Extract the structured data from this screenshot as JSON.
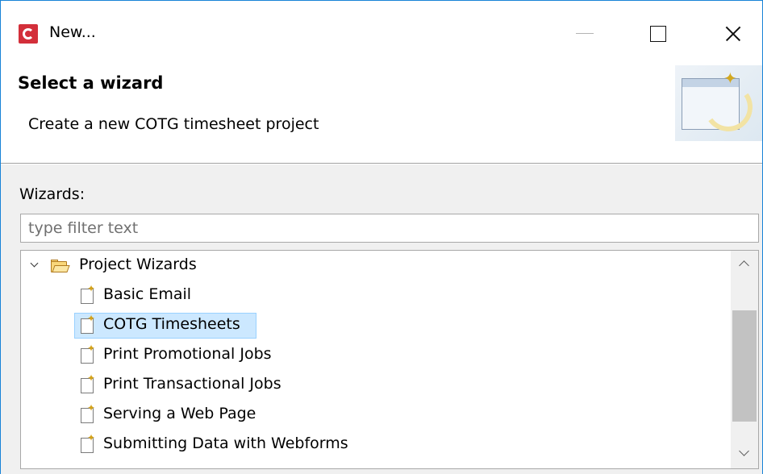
{
  "window": {
    "title": "New...",
    "app_icon": "c-logo-icon",
    "controls": {
      "minimize": "minimize-icon",
      "maximize": "maximize-icon",
      "close": "close-icon"
    }
  },
  "header": {
    "heading": "Select a wizard",
    "description": "Create a new COTG timesheet project",
    "banner_icon": "wizard-banner-icon"
  },
  "wizards": {
    "label": "Wizards:",
    "filter_placeholder": "type filter text",
    "filter_value": "",
    "tree": {
      "group": {
        "label": "Project Wizards",
        "expanded": true,
        "icon": "folder-open-icon"
      },
      "items": [
        {
          "label": "Basic Email",
          "icon": "new-file-icon",
          "selected": false
        },
        {
          "label": "COTG Timesheets",
          "icon": "new-file-icon",
          "selected": true
        },
        {
          "label": "Print Promotional Jobs",
          "icon": "new-file-icon",
          "selected": false
        },
        {
          "label": "Print Transactional Jobs",
          "icon": "new-file-icon",
          "selected": false
        },
        {
          "label": "Serving a Web Page",
          "icon": "new-file-icon",
          "selected": false
        },
        {
          "label": "Submitting Data with Webforms",
          "icon": "new-file-icon",
          "selected": false
        }
      ]
    }
  },
  "colors": {
    "accent_border": "#1883d7",
    "selection_bg": "#cce8ff",
    "app_icon_red": "#d32f3a"
  }
}
